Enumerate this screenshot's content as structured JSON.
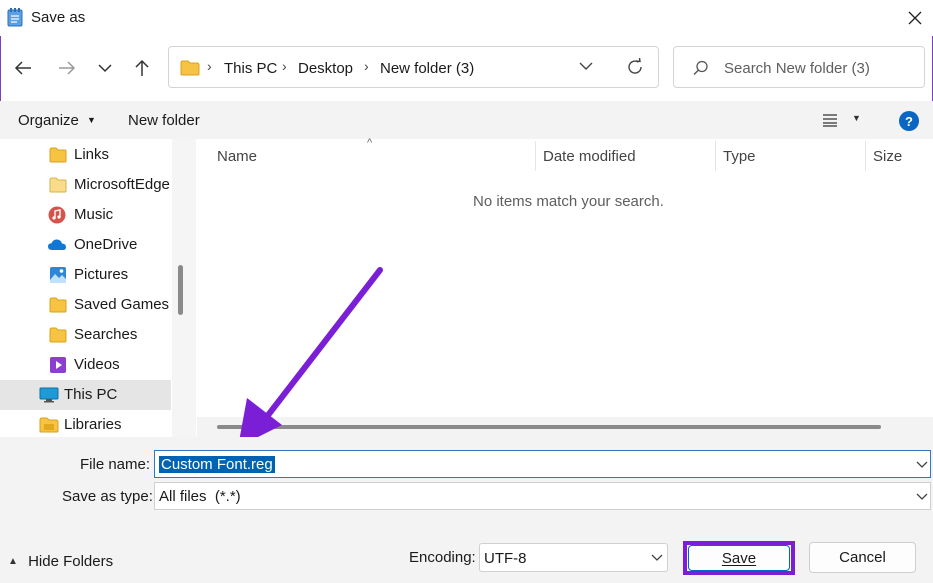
{
  "window": {
    "title": "Save as"
  },
  "address": {
    "crumbs": [
      "This PC",
      "Desktop",
      "New folder (3)"
    ]
  },
  "search": {
    "placeholder": "Search New folder (3)"
  },
  "toolbar": {
    "organize_label": "Organize",
    "new_folder_label": "New folder"
  },
  "sidebar": {
    "items": [
      {
        "label": "Links",
        "icon": "folder-icon"
      },
      {
        "label": "MicrosoftEdge",
        "icon": "folder-icon"
      },
      {
        "label": "Music",
        "icon": "music-icon"
      },
      {
        "label": "OneDrive",
        "icon": "cloud-icon"
      },
      {
        "label": "Pictures",
        "icon": "pictures-icon"
      },
      {
        "label": "Saved Games",
        "icon": "folder-icon"
      },
      {
        "label": "Searches",
        "icon": "folder-icon"
      },
      {
        "label": "Videos",
        "icon": "videos-icon"
      },
      {
        "label": "This PC",
        "icon": "computer-icon",
        "selected": true
      },
      {
        "label": "Libraries",
        "icon": "library-icon"
      }
    ]
  },
  "filelist": {
    "columns": [
      "Name",
      "Date modified",
      "Type",
      "Size"
    ],
    "empty_message": "No items match your search."
  },
  "form": {
    "filename_label": "File name:",
    "filename_value": "Custom Font.reg",
    "savetype_label": "Save as type:",
    "savetype_value": "All files  (*.*)",
    "encoding_label": "Encoding:",
    "encoding_value": "UTF-8",
    "hide_folders_label": "Hide Folders",
    "save_label": "Save",
    "cancel_label": "Cancel"
  },
  "colors": {
    "accent": "#0067c0",
    "annotation": "#7a1fd6",
    "selection": "#0063b1"
  }
}
